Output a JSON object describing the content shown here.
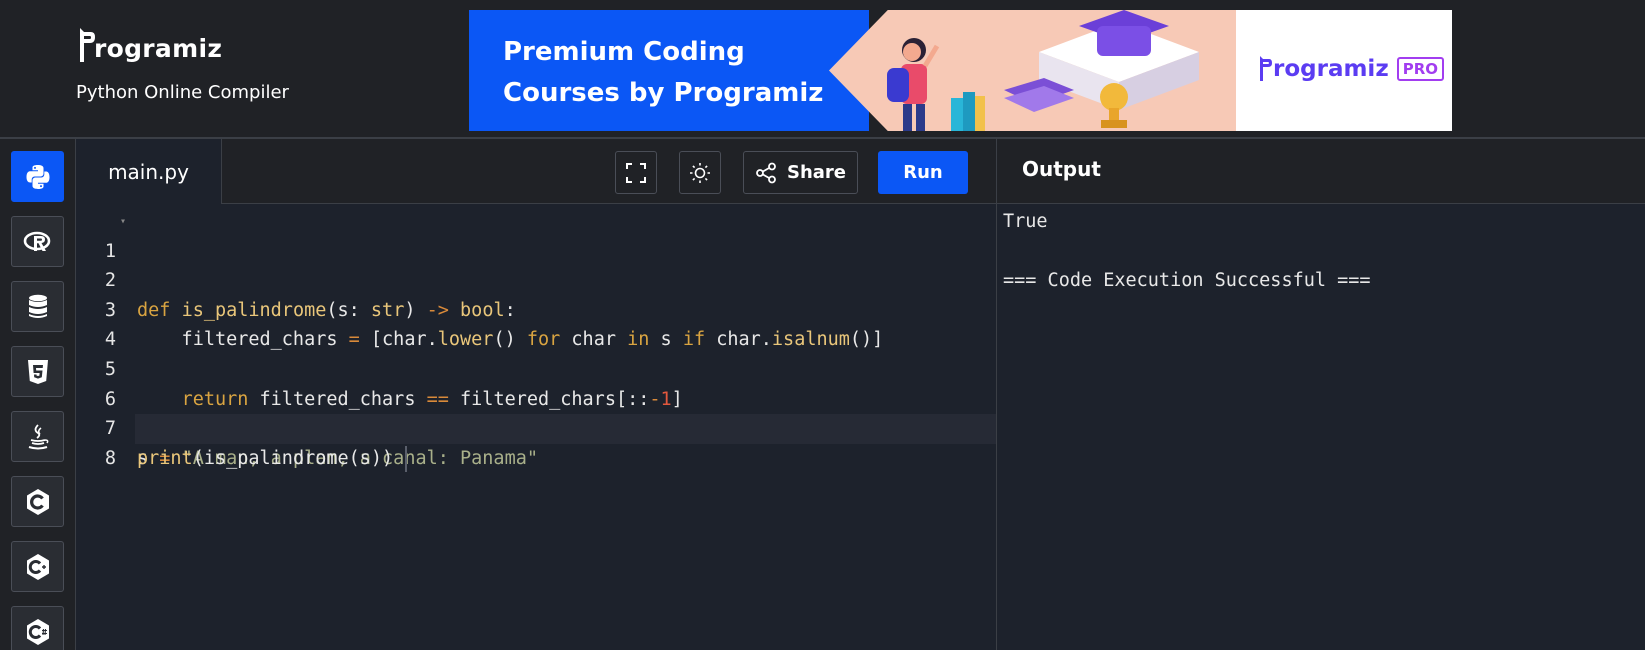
{
  "header": {
    "logo_text": "rogramiz",
    "subtitle": "Python Online Compiler"
  },
  "banner": {
    "line1": "Premium Coding",
    "line2": "Courses by Programiz",
    "pro_logo_text": "rogramiz",
    "pro_badge": "PRO"
  },
  "sidebar": {
    "languages": [
      {
        "name": "python-icon",
        "active": true
      },
      {
        "name": "r-icon",
        "active": false
      },
      {
        "name": "database-icon",
        "active": false
      },
      {
        "name": "html5-icon",
        "active": false
      },
      {
        "name": "java-icon",
        "active": false
      },
      {
        "name": "c-icon",
        "active": false
      },
      {
        "name": "cpp-icon",
        "active": false
      },
      {
        "name": "csharp-icon",
        "active": false
      }
    ]
  },
  "toolbar": {
    "file_tab": "main.py",
    "share_label": "Share",
    "run_label": "Run"
  },
  "output_panel": {
    "title": "Output",
    "lines": [
      "True",
      "",
      "=== Code Execution Successful ==="
    ]
  },
  "editor": {
    "line_numbers": [
      "1",
      "2",
      "3",
      "4",
      "5",
      "6",
      "7",
      "8"
    ],
    "code_lines": [
      "def is_palindrome(s: str) -> bool:",
      "",
      "    filtered_chars = [char.lower() for char in s if char.isalnum()]",
      "",
      "    return filtered_chars == filtered_chars[::-1]",
      "",
      "s = \"A man, a plan, a canal: Panama\"",
      "print(is_palindrome(s))"
    ]
  },
  "colors": {
    "accent": "#0b57f5",
    "background": "#1d222c",
    "header_bg": "#202226"
  }
}
